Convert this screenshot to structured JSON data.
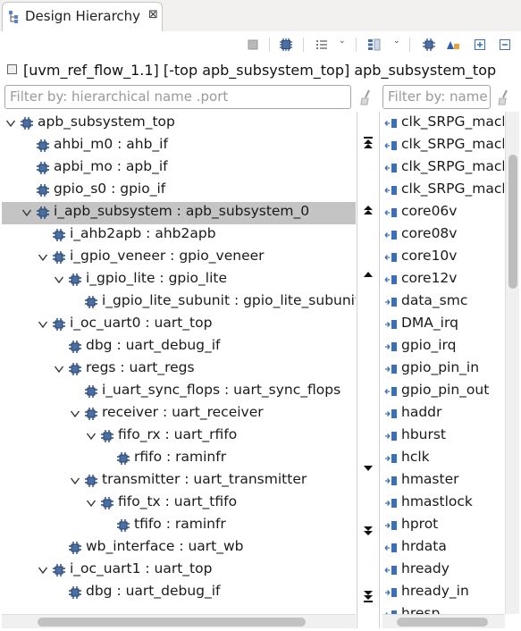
{
  "view": {
    "tab_title": "Design Hierarchy",
    "tab_close": "⊠",
    "context": "[uvm_ref_flow_1.1] [-top apb_subsystem_top] apb_subsystem_top",
    "filter_hierarchy_placeholder": "Filter by: hierarchical name .port",
    "filter_ports_placeholder": "Filter by: name"
  },
  "toolbar": {
    "caret": "⌄",
    "icons": [
      "stop-icon",
      "chip-icon",
      "list-dropdown-icon",
      "columns-dropdown-icon",
      "chip-small-icon",
      "sort-icon",
      "expand-all-icon",
      "collapse-all-icon"
    ]
  },
  "tree": {
    "rows": [
      {
        "label": "apb_subsystem_top",
        "depth": 0,
        "twisty": "open",
        "selected": false
      },
      {
        "label": "ahbi_m0 : ahb_if",
        "depth": 1,
        "twisty": "none",
        "selected": false
      },
      {
        "label": "apbi_mo : apb_if",
        "depth": 1,
        "twisty": "none",
        "selected": false
      },
      {
        "label": "gpio_s0 : gpio_if",
        "depth": 1,
        "twisty": "none",
        "selected": false
      },
      {
        "label": "i_apb_subsystem : apb_subsystem_0",
        "depth": 1,
        "twisty": "open",
        "selected": true
      },
      {
        "label": "i_ahb2apb : ahb2apb",
        "depth": 2,
        "twisty": "none",
        "selected": false
      },
      {
        "label": "i_gpio_veneer : gpio_veneer",
        "depth": 2,
        "twisty": "open",
        "selected": false
      },
      {
        "label": "i_gpio_lite : gpio_lite",
        "depth": 3,
        "twisty": "open",
        "selected": false
      },
      {
        "label": "i_gpio_lite_subunit : gpio_lite_subunit",
        "depth": 4,
        "twisty": "none",
        "selected": false
      },
      {
        "label": "i_oc_uart0 : uart_top",
        "depth": 2,
        "twisty": "open",
        "selected": false
      },
      {
        "label": "dbg : uart_debug_if",
        "depth": 3,
        "twisty": "none",
        "selected": false
      },
      {
        "label": "regs : uart_regs",
        "depth": 3,
        "twisty": "open",
        "selected": false
      },
      {
        "label": "i_uart_sync_flops : uart_sync_flops",
        "depth": 4,
        "twisty": "none",
        "selected": false
      },
      {
        "label": "receiver : uart_receiver",
        "depth": 4,
        "twisty": "open",
        "selected": false
      },
      {
        "label": "fifo_rx : uart_rfifo",
        "depth": 5,
        "twisty": "open",
        "selected": false
      },
      {
        "label": "rfifo : raminfr",
        "depth": 6,
        "twisty": "none",
        "selected": false
      },
      {
        "label": "transmitter : uart_transmitter",
        "depth": 4,
        "twisty": "open",
        "selected": false
      },
      {
        "label": "fifo_tx : uart_tfifo",
        "depth": 5,
        "twisty": "open",
        "selected": false
      },
      {
        "label": "tfifo : raminfr",
        "depth": 6,
        "twisty": "none",
        "selected": false
      },
      {
        "label": "wb_interface : uart_wb",
        "depth": 3,
        "twisty": "none",
        "selected": false
      },
      {
        "label": "i_oc_uart1 : uart_top",
        "depth": 2,
        "twisty": "open",
        "selected": false
      },
      {
        "label": "dbg : uart_debug_if",
        "depth": 3,
        "twisty": "none",
        "selected": false
      }
    ]
  },
  "nav": {
    "buttons": [
      {
        "name": "move-top-button",
        "glyph": "top"
      },
      {
        "name": "page-up-button",
        "glyph": "pageup"
      },
      {
        "name": "step-up-button",
        "glyph": "up"
      },
      {
        "name": "step-down-button",
        "glyph": "down"
      },
      {
        "name": "page-down-button",
        "glyph": "pagedown"
      },
      {
        "name": "move-bottom-button",
        "glyph": "bottom"
      }
    ]
  },
  "ports": {
    "rows": [
      {
        "label": "clk_SRPG_macb",
        "dir": "in"
      },
      {
        "label": "clk_SRPG_macb",
        "dir": "in"
      },
      {
        "label": "clk_SRPG_macb",
        "dir": "in"
      },
      {
        "label": "clk_SRPG_macb",
        "dir": "in"
      },
      {
        "label": "core06v",
        "dir": "in"
      },
      {
        "label": "core08v",
        "dir": "in"
      },
      {
        "label": "core10v",
        "dir": "in"
      },
      {
        "label": "core12v",
        "dir": "in"
      },
      {
        "label": "data_smc",
        "dir": "out"
      },
      {
        "label": "DMA_irq",
        "dir": "out"
      },
      {
        "label": "gpio_irq",
        "dir": "out"
      },
      {
        "label": "gpio_pin_in",
        "dir": "out"
      },
      {
        "label": "gpio_pin_out",
        "dir": "in"
      },
      {
        "label": "haddr",
        "dir": "out"
      },
      {
        "label": "hburst",
        "dir": "out"
      },
      {
        "label": "hclk",
        "dir": "out"
      },
      {
        "label": "hmaster",
        "dir": "out"
      },
      {
        "label": "hmastlock",
        "dir": "out"
      },
      {
        "label": "hprot",
        "dir": "out"
      },
      {
        "label": "hrdata",
        "dir": "in"
      },
      {
        "label": "hready",
        "dir": "in"
      },
      {
        "label": "hready_in",
        "dir": "out"
      },
      {
        "label": "hresp",
        "dir": "in"
      }
    ]
  },
  "colors": {
    "selection": "#c4c4c4",
    "port_blue": "#3b6fb6",
    "chip_blue": "#4a6fa5"
  }
}
